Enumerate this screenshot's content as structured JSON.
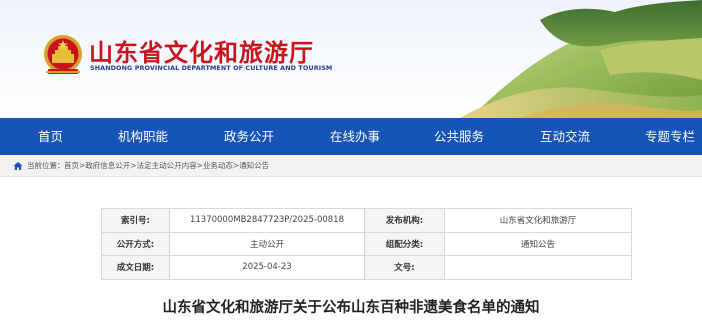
{
  "header": {
    "site_title": "山东省文化和旅游厅",
    "site_subtitle": "SHANDONG PROVINCIAL DEPARTMENT OF CULTURE AND TOURISM"
  },
  "nav": {
    "items": [
      {
        "label": "首页"
      },
      {
        "label": "机构职能"
      },
      {
        "label": "政务公开"
      },
      {
        "label": "在线办事"
      },
      {
        "label": "公共服务"
      },
      {
        "label": "互动交流"
      },
      {
        "label": "专题专栏"
      }
    ]
  },
  "breadcrumb": {
    "label": "当前位置：",
    "items": [
      "首页",
      "政府信息公开",
      "法定主动公开内容",
      "业务动态",
      "通知公告"
    ],
    "separator": ">"
  },
  "info": {
    "index_key": "索引号:",
    "index_value": "11370000MB2847723P/2025-00818",
    "publisher_key": "发布机构:",
    "publisher_value": "山东省文化和旅游厅",
    "mode_key": "公开方式:",
    "mode_value": "主动公开",
    "category_key": "组配分类:",
    "category_value": "通知公告",
    "date_key": "成文日期:",
    "date_value": "2025-04-23",
    "doc_no_key": "文号:",
    "doc_no_value": ""
  },
  "article": {
    "title": "山东省文化和旅游厅关于公布山东百种非遗美食名单的通知"
  },
  "colors": {
    "nav_bg": "#1655b6",
    "title_red": "#c8141c",
    "subtitle_blue": "#1f3f8f"
  }
}
